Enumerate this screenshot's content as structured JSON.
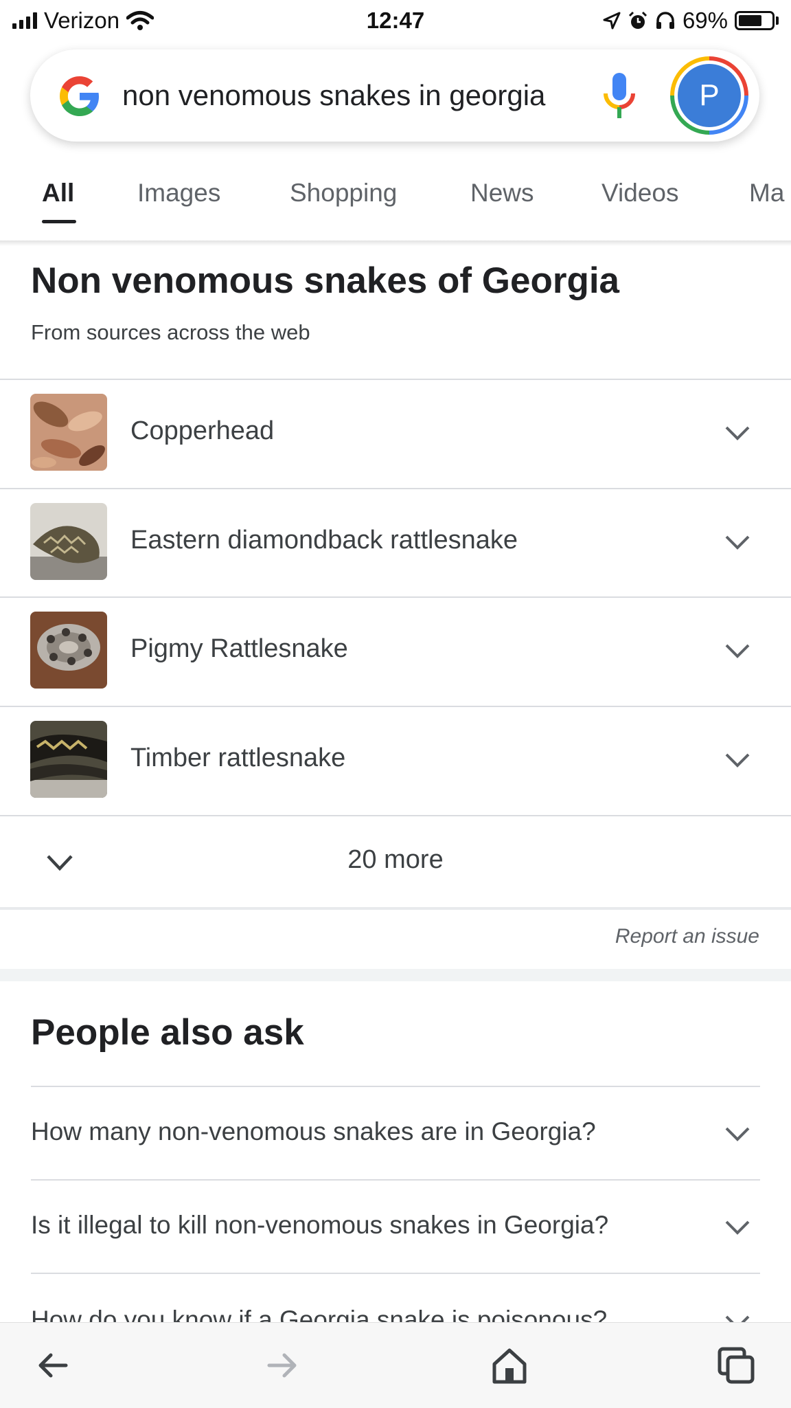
{
  "status_bar": {
    "carrier": "Verizon",
    "time": "12:47",
    "battery": "69%",
    "battery_level": 0.69
  },
  "search": {
    "query": "non venomous snakes in georgia",
    "avatar_letter": "P"
  },
  "tabs": [
    {
      "label": "All",
      "active": true
    },
    {
      "label": "Images"
    },
    {
      "label": "Shopping"
    },
    {
      "label": "News"
    },
    {
      "label": "Videos"
    },
    {
      "label": "Ma"
    }
  ],
  "knowledge": {
    "title": "Non venomous snakes of Georgia",
    "subtitle": "From sources across the web",
    "items": [
      {
        "label": "Copperhead",
        "thumb": "copperhead-photo"
      },
      {
        "label": "Eastern diamondback rattlesnake",
        "thumb": "diamondback-photo"
      },
      {
        "label": "Pigmy Rattlesnake",
        "thumb": "pigmy-rattlesnake-photo"
      },
      {
        "label": "Timber rattlesnake",
        "thumb": "timber-rattlesnake-photo"
      }
    ],
    "more_label": "20 more",
    "report_label": "Report an issue"
  },
  "paa": {
    "title": "People also ask",
    "questions": [
      "How many non-venomous snakes are in Georgia?",
      "Is it illegal to kill non-venomous snakes in Georgia?",
      "How do you know if a Georgia snake is poisonous?"
    ]
  },
  "icons": {
    "google_logo": "google-logo-icon",
    "mic": "mic-icon",
    "expand": "chevron-down-icon",
    "back": "back-arrow-icon",
    "forward": "forward-arrow-icon",
    "home": "home-icon",
    "tabs": "tabs-icon"
  },
  "colors": {
    "google_blue": "#4285f4",
    "google_red": "#ea4335",
    "google_yellow": "#fbbc05",
    "google_green": "#34a853",
    "avatar": "#3b7dd8"
  }
}
